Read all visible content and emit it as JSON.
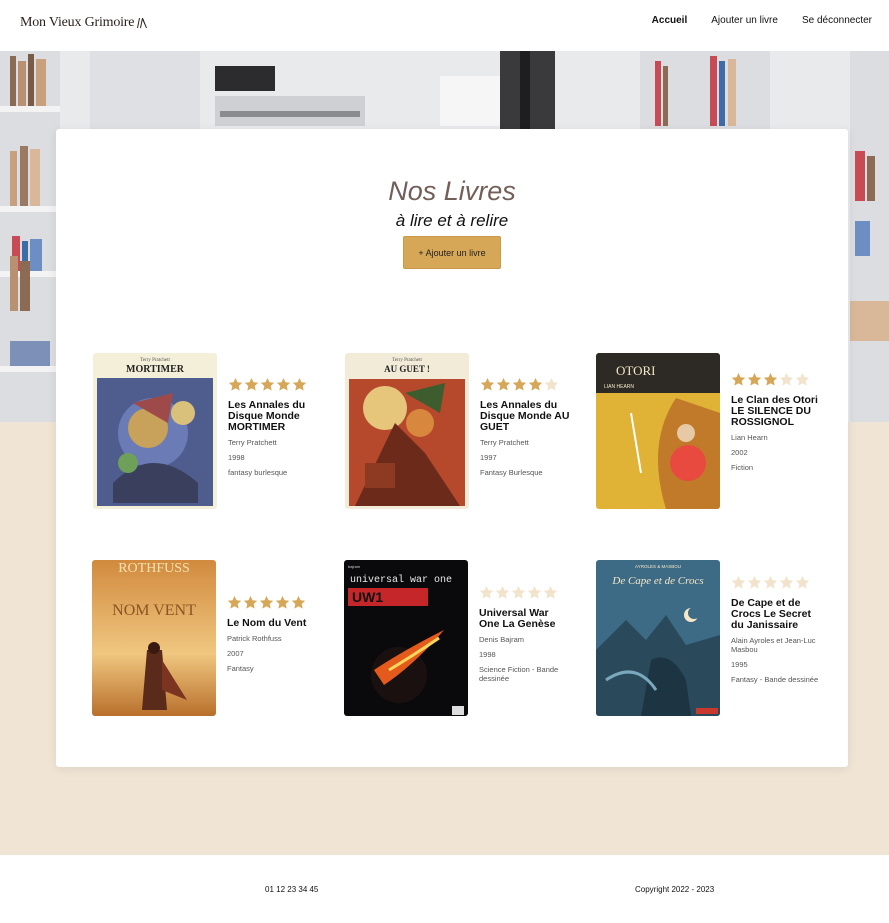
{
  "header": {
    "logo_text": "Mon Vieux Grimoire",
    "nav": [
      "Accueil",
      "Ajouter un livre",
      "Se déconnecter"
    ]
  },
  "main": {
    "title": "Nos Livres",
    "subtitle": "à lire et à relire",
    "add_button": "+ Ajouter un livre"
  },
  "colors": {
    "accent": "#d7a758",
    "star_on": "#d7a758",
    "star_off": "#f1e3cc",
    "beige": "#f0e4d5"
  },
  "books": [
    {
      "title": "Les Annales du Disque Monde MORTIMER",
      "author": "Terry Pratchett",
      "year": "1998",
      "genre": "fantasy burlesque",
      "rating": 5,
      "cover_text": "MORTIMER",
      "cover_top": "Terry Pratchett"
    },
    {
      "title": "Les Annales du Disque Monde AU GUET",
      "author": "Terry Pratchett",
      "year": "1997",
      "genre": "Fantasy Burlesque",
      "rating": 4,
      "cover_text": "AU GUET !",
      "cover_top": "Terry Pratchett"
    },
    {
      "title": "Le Clan des Otori LE SILENCE DU ROSSIGNOL",
      "author": "Lian Hearn",
      "year": "2002",
      "genre": "Fiction",
      "rating": 3,
      "cover_text": "OTORI",
      "cover_top": "LIAN HEARN"
    },
    {
      "title": "Le Nom du Vent",
      "author": "Patrick Rothfuss",
      "year": "2007",
      "genre": "Fantasy",
      "rating": 5,
      "cover_text": "ROTHFUSS",
      "cover_top": "NOM VENT"
    },
    {
      "title": "Universal War One La Genèse",
      "author": "Denis Bajram",
      "year": "1998",
      "genre": "Science Fiction - Bande dessinée",
      "rating": 0,
      "cover_text": "universal war one",
      "cover_top": "UW1"
    },
    {
      "title": "De Cape et de Crocs Le Secret du Janissaire",
      "author": "Alain Ayroles et Jean-Luc Masbou",
      "year": "1995",
      "genre": "Fantasy - Bande dessinée",
      "rating": 0,
      "cover_text": "De Cape et de Crocs",
      "cover_top": "AYROLES & MASBOU"
    }
  ],
  "footer": {
    "phone": "01 12 23 34 45",
    "copyright": "Copyright 2022 - 2023"
  }
}
